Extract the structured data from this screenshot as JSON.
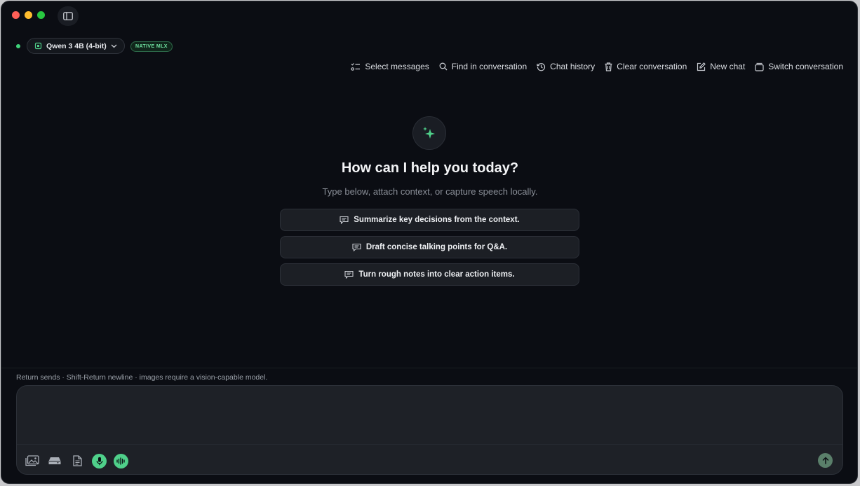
{
  "window": {
    "controls": [
      "close",
      "minimize",
      "zoom"
    ]
  },
  "sidebar_toggle": {
    "icon": "sidebar-icon"
  },
  "model": {
    "name": "Qwen 3 4B (4-bit)",
    "badge": "NATIVE MLX",
    "status_color": "#3fd17a"
  },
  "toolbar": {
    "select_messages": "Select messages",
    "find": "Find in conversation",
    "history": "Chat history",
    "clear": "Clear conversation",
    "new_chat": "New chat",
    "switch": "Switch conversation"
  },
  "hero": {
    "icon": "sparkles-icon",
    "title": "How can I help you today?",
    "subtitle": "Type below, attach context, or capture speech locally."
  },
  "suggestions": [
    "Summarize key decisions from the context.",
    "Draft concise talking points for Q&A.",
    "Turn rough notes into clear action items."
  ],
  "composer": {
    "hint": "Return sends · Shift-Return newline · images require a vision-capable model.",
    "placeholder": "",
    "tools": [
      "image-icon",
      "drive-icon",
      "document-icon",
      "microphone-icon",
      "waveform-icon"
    ],
    "send_icon": "arrow-up-icon"
  },
  "colors": {
    "accent": "#4fd08a",
    "background": "#0b0d13",
    "surface": "#1e2127"
  }
}
